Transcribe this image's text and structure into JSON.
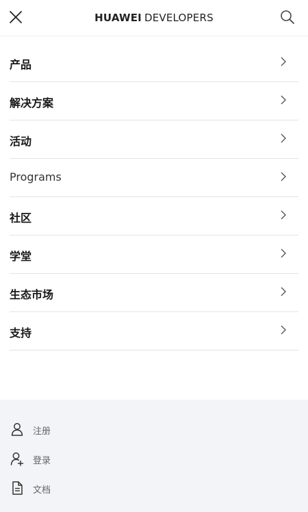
{
  "header": {
    "logo_brand": "HUAWEI",
    "logo_suffix": "DEVELOPERS",
    "close_icon": "close-icon",
    "search_icon": "search-icon"
  },
  "menu": {
    "items": [
      {
        "label": "产品"
      },
      {
        "label": "解决方案"
      },
      {
        "label": "活动"
      },
      {
        "label": "Programs"
      },
      {
        "label": "社区"
      },
      {
        "label": "学堂"
      },
      {
        "label": "生态市场"
      },
      {
        "label": "支持"
      }
    ],
    "chevron_icon": "chevron-right-icon"
  },
  "footer": {
    "links": [
      {
        "label": "注册",
        "icon": "user-icon"
      },
      {
        "label": "登录",
        "icon": "user-add-icon"
      },
      {
        "label": "文档",
        "icon": "document-icon"
      }
    ]
  },
  "colors": {
    "text": "#191919",
    "divider": "#e3e3e3",
    "footer_bg": "#f3f4f7",
    "footer_text": "#666666"
  }
}
